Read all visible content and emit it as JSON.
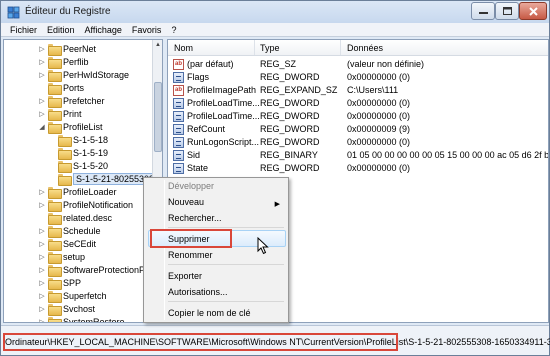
{
  "window": {
    "title": "Éditeur du Registre"
  },
  "menubar": {
    "items": [
      "Fichier",
      "Edition",
      "Affichage",
      "Favoris",
      "?"
    ]
  },
  "tree": {
    "items": [
      {
        "label": "PeerNet",
        "level": 0,
        "expander": "▷"
      },
      {
        "label": "Perflib",
        "level": 0,
        "expander": "▷"
      },
      {
        "label": "PerHwIdStorage",
        "level": 0,
        "expander": "▷"
      },
      {
        "label": "Ports",
        "level": 0,
        "expander": ""
      },
      {
        "label": "Prefetcher",
        "level": 0,
        "expander": "▷"
      },
      {
        "label": "Print",
        "level": 0,
        "expander": "▷"
      },
      {
        "label": "ProfileList",
        "level": 0,
        "expander": "◢"
      },
      {
        "label": "S-1-5-18",
        "level": 1,
        "expander": ""
      },
      {
        "label": "S-1-5-19",
        "level": 1,
        "expander": ""
      },
      {
        "label": "S-1-5-20",
        "level": 1,
        "expander": ""
      },
      {
        "label": "S-1-5-21-80255308",
        "level": 1,
        "expander": "",
        "selected": true
      },
      {
        "label": "ProfileLoader",
        "level": 0,
        "expander": "▷"
      },
      {
        "label": "ProfileNotification",
        "level": 0,
        "expander": "▷"
      },
      {
        "label": "related.desc",
        "level": 0,
        "expander": ""
      },
      {
        "label": "Schedule",
        "level": 0,
        "expander": "▷"
      },
      {
        "label": "SeCEdit",
        "level": 0,
        "expander": "▷"
      },
      {
        "label": "setup",
        "level": 0,
        "expander": "▷"
      },
      {
        "label": "SoftwareProtectionP",
        "level": 0,
        "expander": "▷"
      },
      {
        "label": "SPP",
        "level": 0,
        "expander": "▷"
      },
      {
        "label": "Superfetch",
        "level": 0,
        "expander": "▷"
      },
      {
        "label": "Svchost",
        "level": 0,
        "expander": "▷"
      },
      {
        "label": "SystemRestore",
        "level": 0,
        "expander": "▷"
      }
    ]
  },
  "list": {
    "columns": [
      "Nom",
      "Type",
      "Données"
    ],
    "rows": [
      {
        "icon": "string-value-icon",
        "name": "(par défaut)",
        "type": "REG_SZ",
        "data": "(valeur non définie)"
      },
      {
        "icon": "binary-value-icon",
        "name": "Flags",
        "type": "REG_DWORD",
        "data": "0x00000000 (0)"
      },
      {
        "icon": "string-value-icon",
        "name": "ProfileImagePath",
        "type": "REG_EXPAND_SZ",
        "data": "C:\\Users\\111"
      },
      {
        "icon": "binary-value-icon",
        "name": "ProfileLoadTime...",
        "type": "REG_DWORD",
        "data": "0x00000000 (0)"
      },
      {
        "icon": "binary-value-icon",
        "name": "ProfileLoadTime...",
        "type": "REG_DWORD",
        "data": "0x00000000 (0)"
      },
      {
        "icon": "binary-value-icon",
        "name": "RefCount",
        "type": "REG_DWORD",
        "data": "0x00000009 (9)"
      },
      {
        "icon": "binary-value-icon",
        "name": "RunLogonScript...",
        "type": "REG_DWORD",
        "data": "0x00000000 (0)"
      },
      {
        "icon": "binary-value-icon",
        "name": "Sid",
        "type": "REG_BINARY",
        "data": "01 05 00 00 00 00 00 05 15 00 00 00 ac 05 d6 2f bf 1c..."
      },
      {
        "icon": "binary-value-icon",
        "name": "State",
        "type": "REG_DWORD",
        "data": "0x00000000 (0)"
      }
    ]
  },
  "context_menu": {
    "items": [
      {
        "label": "Développer",
        "disabled": true
      },
      {
        "label": "Nouveau",
        "submenu": true
      },
      {
        "label": "Rechercher..."
      },
      {
        "label": "Supprimer",
        "highlighted": true
      },
      {
        "label": "Renommer"
      },
      {
        "label": "Exporter"
      },
      {
        "label": "Autorisations..."
      },
      {
        "label": "Copier le nom de clé"
      }
    ],
    "submenu_arrow": "▶"
  },
  "statusbar": {
    "path": "Ordinateur\\HKEY_LOCAL_MACHINE\\SOFTWARE\\Microsoft\\Windows NT\\CurrentVersion\\ProfileList\\S-1-5-21-802555308-1650334911-391"
  },
  "colors": {
    "highlight_border": "#d9473a",
    "menu_hover": "#dcecfc"
  }
}
